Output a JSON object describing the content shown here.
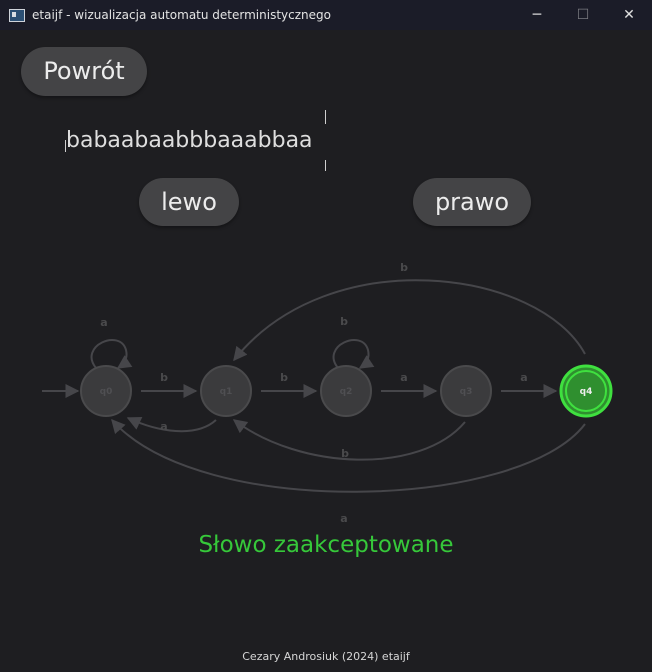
{
  "window": {
    "title": "etaijf - wizualizacja automatu deterministycznego",
    "minimize_glyph": "─",
    "maximize_glyph": "☐",
    "close_glyph": "✕"
  },
  "buttons": {
    "back_label": "Powrót",
    "left_label": "lewo",
    "right_label": "prawo"
  },
  "tape": {
    "word": "babaabaabbbaaabbaa"
  },
  "automaton": {
    "states": [
      "q0",
      "q1",
      "q2",
      "q3",
      "q4"
    ],
    "accepting_state": "q4",
    "current_state": "q4",
    "transitions": [
      {
        "from": "start",
        "to": "q0",
        "label": ""
      },
      {
        "from": "q0",
        "to": "q0",
        "label": "a"
      },
      {
        "from": "q0",
        "to": "q1",
        "label": "b"
      },
      {
        "from": "q1",
        "to": "q0",
        "label": "a"
      },
      {
        "from": "q1",
        "to": "q2",
        "label": "b"
      },
      {
        "from": "q2",
        "to": "q2",
        "label": "b"
      },
      {
        "from": "q2",
        "to": "q3",
        "label": "a"
      },
      {
        "from": "q3",
        "to": "q1",
        "label": "b"
      },
      {
        "from": "q3",
        "to": "q4",
        "label": "a"
      },
      {
        "from": "q4",
        "to": "q1",
        "label": "b"
      },
      {
        "from": "q4",
        "to": "q0",
        "label": "a"
      }
    ],
    "colors": {
      "inactive": "#3b3b3d",
      "inactive_stroke": "#4a4a4c",
      "active_fill": "#2f8f2f",
      "active_ring": "#3fe03f"
    }
  },
  "status": {
    "message": "Słowo zaakceptowane",
    "color": "#36c83a"
  },
  "footer": {
    "credit": "Cezary Androsiuk (2024) etaijf"
  }
}
